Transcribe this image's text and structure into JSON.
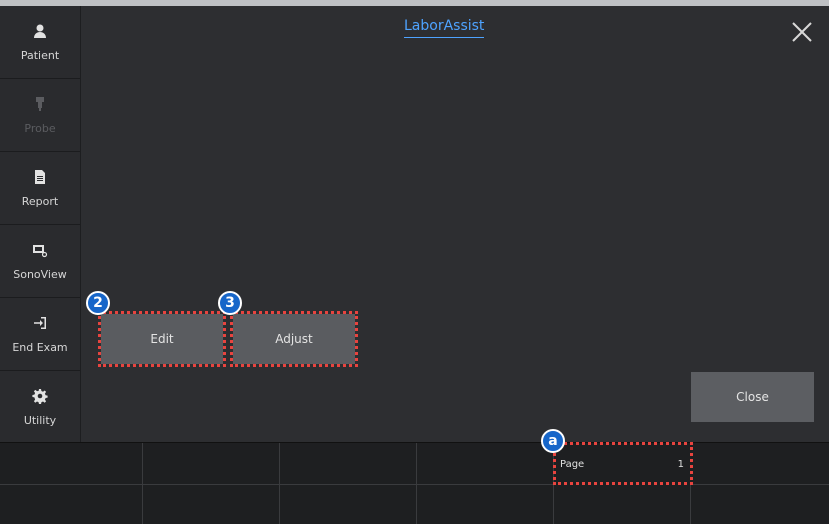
{
  "app": {
    "title": "LaborAssist"
  },
  "sidebar": {
    "items": [
      {
        "label": "Patient",
        "icon": "patient-icon",
        "enabled": true
      },
      {
        "label": "Probe",
        "icon": "probe-icon",
        "enabled": false
      },
      {
        "label": "Report",
        "icon": "report-icon",
        "enabled": true
      },
      {
        "label": "SonoView",
        "icon": "sonoview-icon",
        "enabled": true
      },
      {
        "label": "End Exam",
        "icon": "end-exam-icon",
        "enabled": true
      },
      {
        "label": "Utility",
        "icon": "gear-icon",
        "enabled": true
      }
    ]
  },
  "main": {
    "edit_label": "Edit",
    "adjust_label": "Adjust",
    "close_label": "Close"
  },
  "annotations": {
    "edit_marker": "2",
    "adjust_marker": "3",
    "page_marker": "a"
  },
  "bottom": {
    "page_label": "Page",
    "page_value": "1"
  },
  "colors": {
    "accent": "#4ea3ff",
    "highlight": "#e8443f",
    "marker": "#1766c9"
  }
}
